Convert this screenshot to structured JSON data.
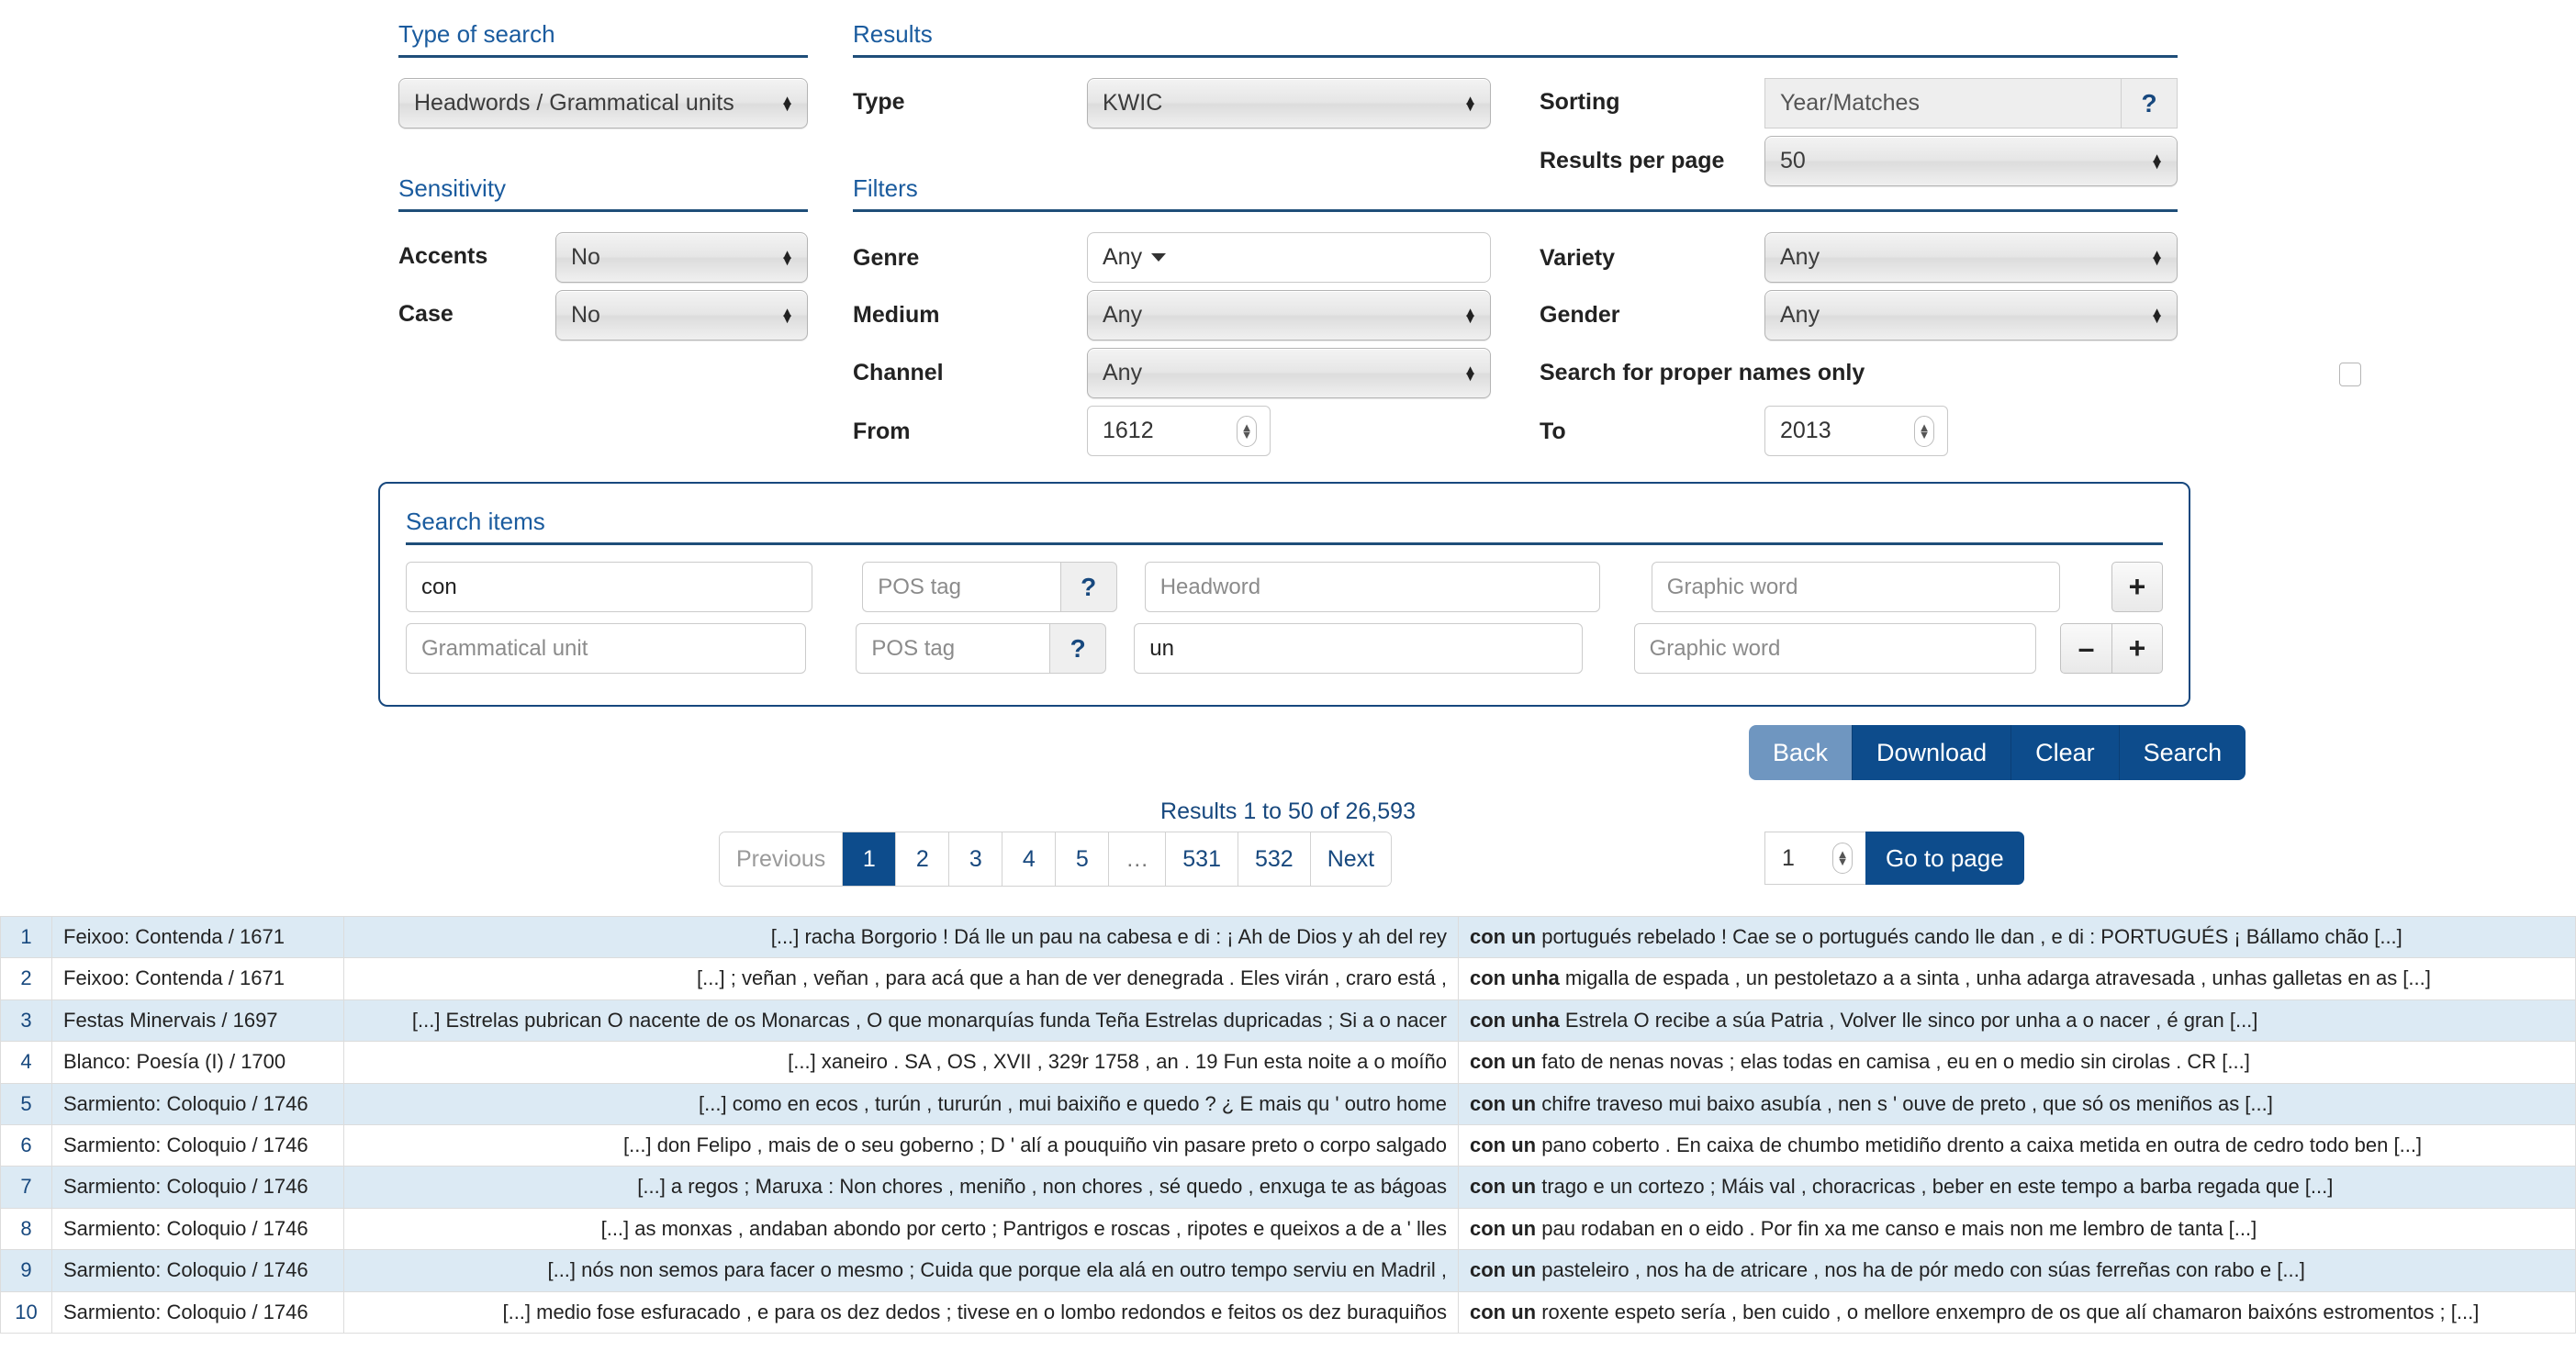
{
  "sections": {
    "type_of_search": "Type of search",
    "results": "Results",
    "sensitivity": "Sensitivity",
    "filters": "Filters",
    "search_items": "Search items"
  },
  "type_of_search": {
    "value": "Headwords / Grammatical units"
  },
  "results_panel": {
    "type_label": "Type",
    "type_value": "KWIC",
    "sorting_label": "Sorting",
    "sorting_value": "Year/Matches",
    "sorting_help": "?",
    "per_page_label": "Results per page",
    "per_page_value": "50"
  },
  "sensitivity": {
    "accents_label": "Accents",
    "accents_value": "No",
    "case_label": "Case",
    "case_value": "No"
  },
  "filters": {
    "genre_label": "Genre",
    "genre_value": "Any",
    "medium_label": "Medium",
    "medium_value": "Any",
    "channel_label": "Channel",
    "channel_value": "Any",
    "from_label": "From",
    "from_value": "1612",
    "variety_label": "Variety",
    "variety_value": "Any",
    "gender_label": "Gender",
    "gender_value": "Any",
    "proper_names_label": "Search for proper names only",
    "to_label": "To",
    "to_value": "2013"
  },
  "search_items": {
    "row1": {
      "unit_value": "con",
      "unit_placeholder": "Grammatical unit",
      "pos_placeholder": "POS tag",
      "pos_help": "?",
      "headword_value": "",
      "headword_placeholder": "Headword",
      "graphic_value": "",
      "graphic_placeholder": "Graphic word",
      "add_label": "+"
    },
    "row2": {
      "unit_value": "",
      "unit_placeholder": "Grammatical unit",
      "pos_placeholder": "POS tag",
      "pos_help": "?",
      "headword_value": "un",
      "headword_placeholder": "Headword",
      "graphic_value": "",
      "graphic_placeholder": "Graphic word",
      "remove_label": "–",
      "add_label": "+"
    }
  },
  "actions": {
    "back": "Back",
    "download": "Download",
    "clear": "Clear",
    "search": "Search"
  },
  "pagination": {
    "results_count": "Results 1 to 50 of 26,593",
    "previous": "Previous",
    "pages": [
      "1",
      "2",
      "3",
      "4",
      "5",
      "…",
      "531",
      "532"
    ],
    "active_page": "1",
    "gap_page": "…",
    "next": "Next",
    "goto_value": "1",
    "goto_label": "Go to page"
  },
  "colors": {
    "accent_blue": "#17487e",
    "button_blue": "#0d4c8c",
    "button_blue_light": "#6f96c0",
    "heading_blue": "#1a5b9e",
    "row_stripe": "#dceaf4"
  },
  "results_table": {
    "rows": [
      {
        "index": "1",
        "source": "Feixoo: Contenda / 1671",
        "left": "[...] racha Borgorio ! Dá lle un pau na cabesa e di : ¡ Ah de Dios y ah del rey",
        "keyword": "con un",
        "right": "portugués rebelado ! Cae se o portugués cando lle dan , e di : PORTUGUÉS ¡ Bállamo chão [...]"
      },
      {
        "index": "2",
        "source": "Feixoo: Contenda / 1671",
        "left": "[...] ; veñan , veñan , para acá que a han de ver denegrada . Eles virán , craro está ,",
        "keyword": "con unha",
        "right": "migalla de espada , un pestoletazo a a sinta , unha adarga atravesada , unhas galletas en as [...]"
      },
      {
        "index": "3",
        "source": "Festas Minervais / 1697",
        "left": "[...] Estrelas pubrican O nacente de os Monarcas , O que monarquías funda Teña Estrelas dupricadas ; Si a o nacer",
        "keyword": "con unha",
        "right": "Estrela O recibe a súa Patria , Volver lle sinco por unha a o nacer , é gran [...]"
      },
      {
        "index": "4",
        "source": "Blanco: Poesía (I) / 1700",
        "left": "[...] xaneiro . SA , OS , XVII , 329r 1758 , an . 19 Fun esta noite a o moíño",
        "keyword": "con un",
        "right": "fato de nenas novas ; elas todas en camisa , eu en o medio sin cirolas . CR [...]"
      },
      {
        "index": "5",
        "source": "Sarmiento: Coloquio / 1746",
        "left": "[...] como en ecos , turún , tururún , mui baixiño e quedo ? ¿ E mais qu ' outro home",
        "keyword": "con un",
        "right": "chifre traveso mui baixo asubía , nen s ' ouve de preto , que só os meniños as [...]"
      },
      {
        "index": "6",
        "source": "Sarmiento: Coloquio / 1746",
        "left": "[...] don Felipo , mais de o seu goberno ; D ' alí a pouquiño vin pasare preto o corpo salgado",
        "keyword": "con un",
        "right": "pano coberto . En caixa de chumbo metidiño drento a caixa metida en outra de cedro todo ben [...]"
      },
      {
        "index": "7",
        "source": "Sarmiento: Coloquio / 1746",
        "left": "[...] a regos ; Maruxa : Non chores , meniño , non chores , sé quedo , enxuga te as bágoas",
        "keyword": "con un",
        "right": "trago e un cortezo ; Máis val , choracricas , beber en este tempo a barba regada que [...]"
      },
      {
        "index": "8",
        "source": "Sarmiento: Coloquio / 1746",
        "left": "[...] as monxas , andaban abondo por certo ; Pantrigos e roscas , ripotes e queixos a de a ' lles",
        "keyword": "con un",
        "right": "pau rodaban en o eido . Por fin xa me canso e mais non me lembro de tanta [...]"
      },
      {
        "index": "9",
        "source": "Sarmiento: Coloquio / 1746",
        "left": "[...] nós non semos para facer o mesmo ; Cuida que porque ela alá en outro tempo serviu en Madril ,",
        "keyword": "con un",
        "right": "pasteleiro , nos ha de atricare , nos ha de pór medo con súas ferreñas con rabo e [...]"
      },
      {
        "index": "10",
        "source": "Sarmiento: Coloquio / 1746",
        "left": "[...] medio fose esfuracado , e para os dez dedos ; tivese en o lombo redondos e feitos os dez buraquiños",
        "keyword": "con un",
        "right": "roxente espeto sería , ben cuido , o mellore enxempro de os que alí chamaron baixóns estromentos ; [...]"
      }
    ]
  }
}
